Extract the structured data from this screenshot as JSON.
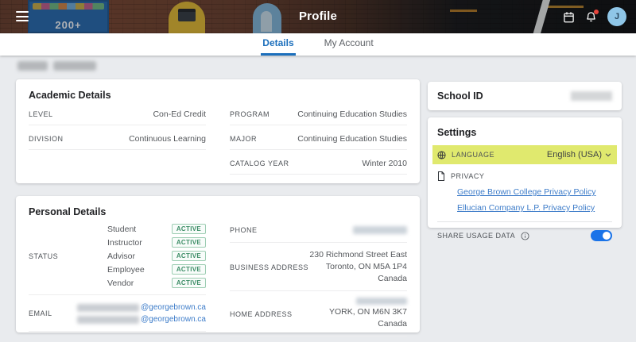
{
  "header": {
    "title": "Profile",
    "avatar_initial": "J"
  },
  "tabs": {
    "details": "Details",
    "my_account": "My Account"
  },
  "academic": {
    "title": "Academic Details",
    "left_rows": [
      {
        "label": "LEVEL",
        "value": "Con-Ed Credit"
      },
      {
        "label": "DIVISION",
        "value": "Continuous Learning"
      }
    ],
    "right_rows": [
      {
        "label": "PROGRAM",
        "value": "Continuing Education Studies"
      },
      {
        "label": "MAJOR",
        "value": "Continuing Education Studies"
      },
      {
        "label": "CATALOG YEAR",
        "value": "Winter 2010"
      }
    ]
  },
  "personal": {
    "title": "Personal Details",
    "status_label": "STATUS",
    "statuses": [
      {
        "name": "Student",
        "badge": "ACTIVE"
      },
      {
        "name": "Instructor",
        "badge": "ACTIVE"
      },
      {
        "name": "Advisor",
        "badge": "ACTIVE"
      },
      {
        "name": "Employee",
        "badge": "ACTIVE"
      },
      {
        "name": "Vendor",
        "badge": "ACTIVE"
      }
    ],
    "email_label": "EMAIL",
    "email_domain": "@georgebrown.ca",
    "phone_label": "PHONE",
    "business_address_label": "BUSINESS ADDRESS",
    "business_address": [
      "230 Richmond Street East",
      "Toronto, ON M5A 1P4",
      "Canada"
    ],
    "home_address_label": "HOME ADDRESS",
    "home_address_lines": [
      "YORK, ON M6N 3K7",
      "Canada"
    ]
  },
  "school_id": {
    "title": "School ID"
  },
  "settings": {
    "title": "Settings",
    "language_label": "LANGUAGE",
    "language_value": "English (USA)",
    "privacy_label": "PRIVACY",
    "privacy_links": [
      "George Brown College Privacy Policy",
      "Ellucian Company L.P. Privacy Policy"
    ],
    "share_usage_label": "SHARE USAGE DATA"
  },
  "colors": {
    "tab_active": "#1c6fbc",
    "link": "#3d7cc9",
    "badge_green": "#3c8d66",
    "language_highlight": "#e0e96e",
    "toggle_on": "#1a73e8",
    "notification_dot": "#e8453c"
  }
}
